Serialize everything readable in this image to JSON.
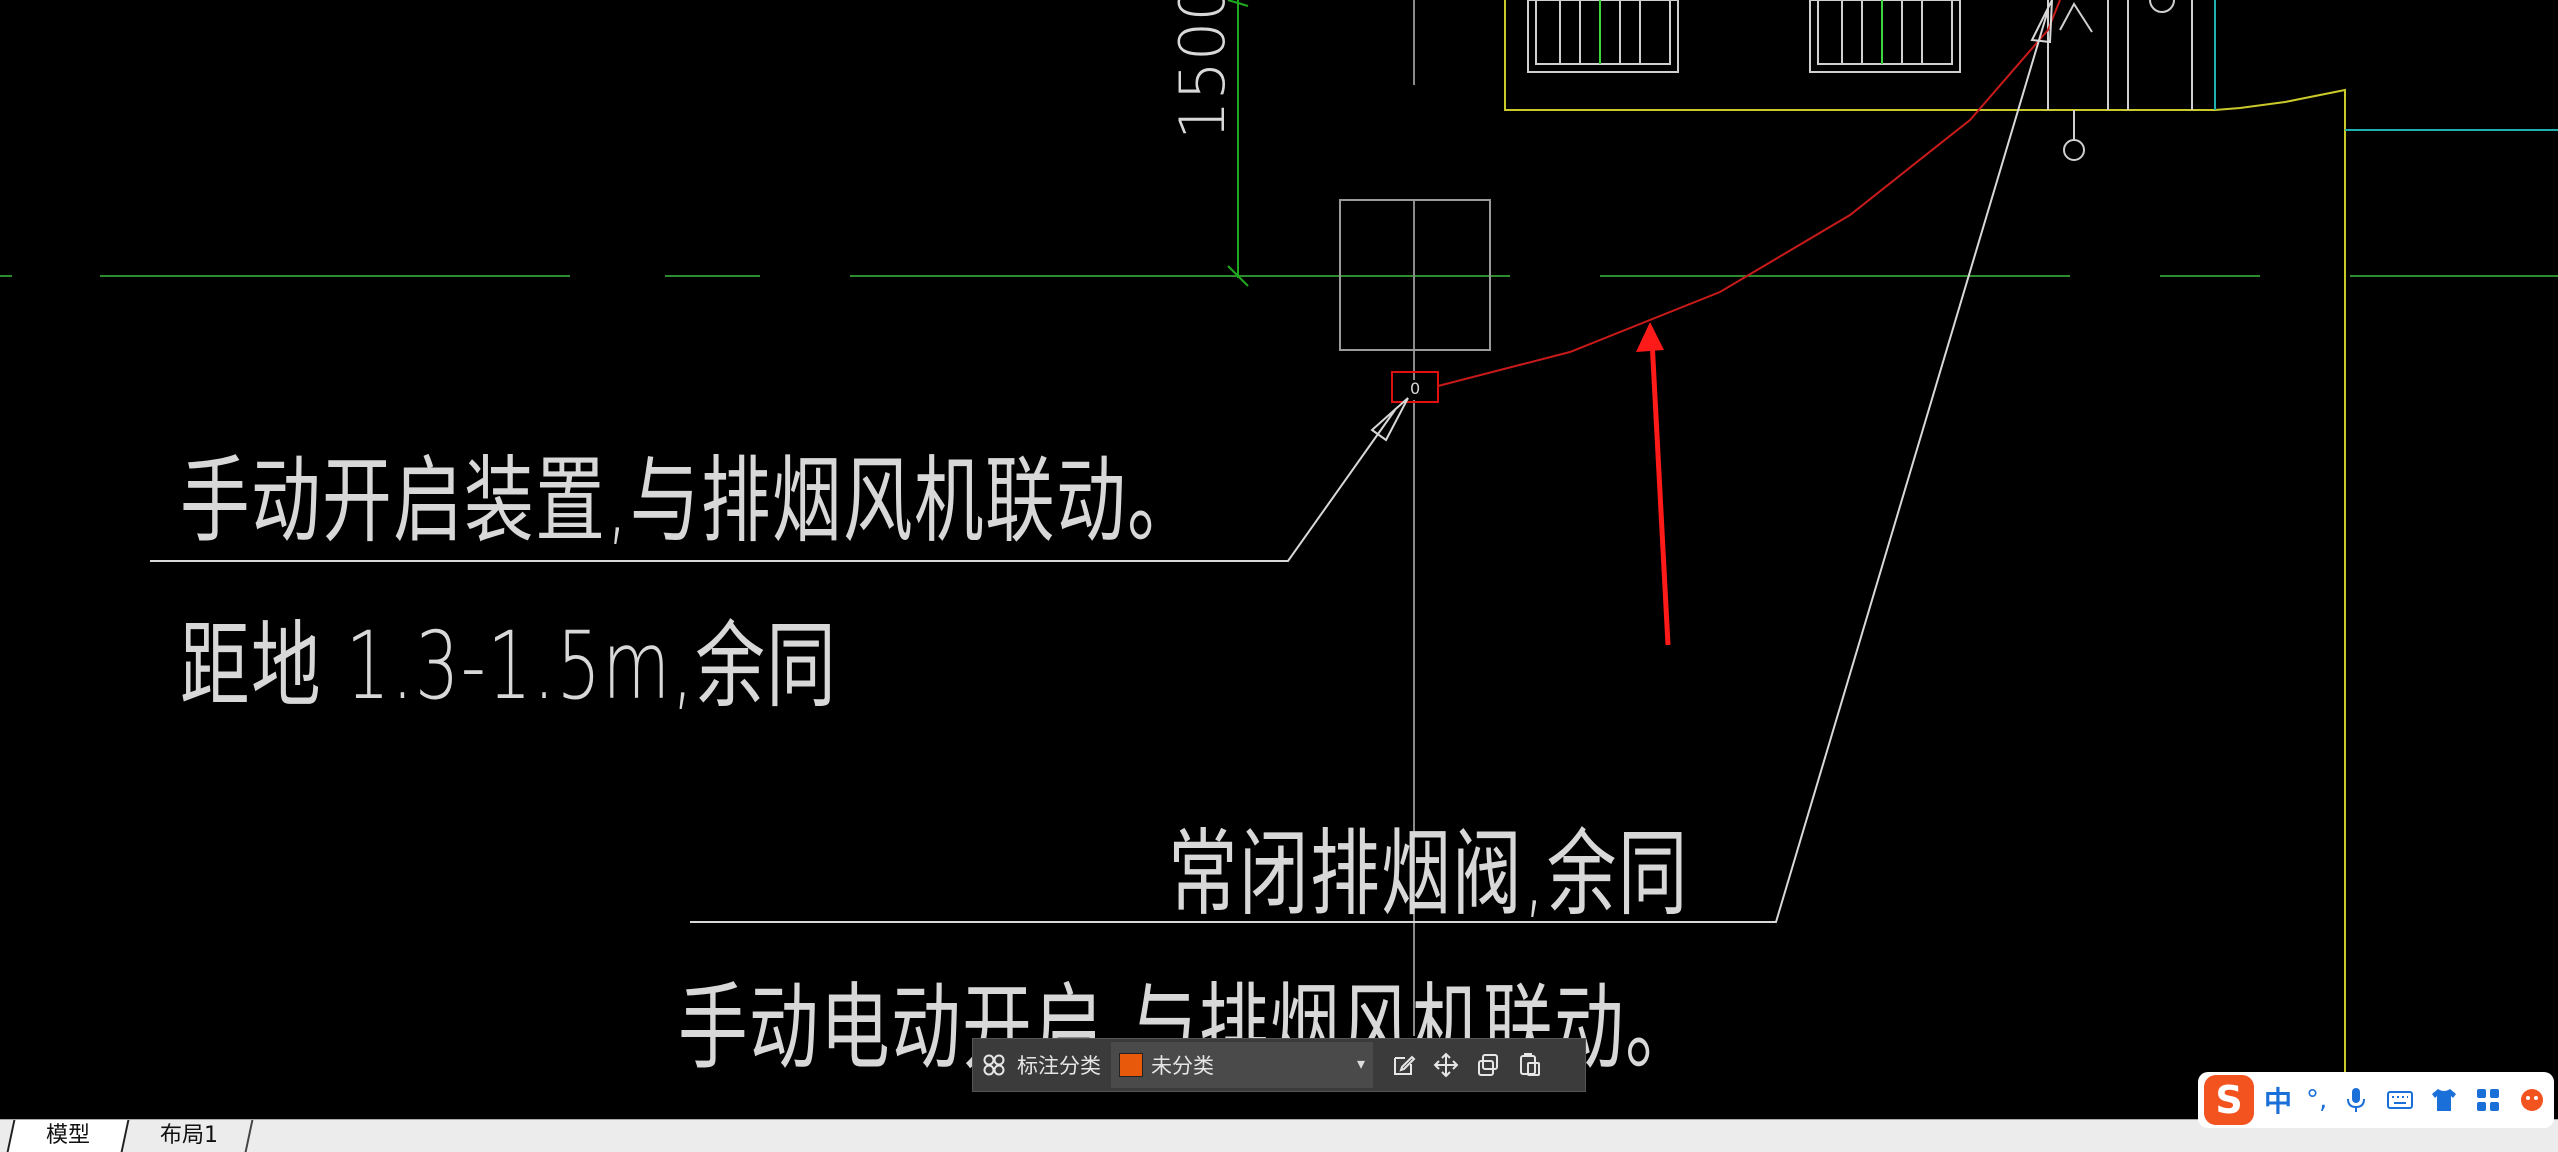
{
  "drawing": {
    "dimension_label": "1500",
    "annotations": [
      "手动开启装置,与排烟风机联动。",
      "距地 1.3-1.5m,余同",
      "常闭排烟阀,余同",
      "手动电动开启,与排烟风机联动。"
    ]
  },
  "annotation_toolbar": {
    "category_label": "标注分类",
    "category_value": "未分类",
    "swatch_color": "#e8590c",
    "icons": [
      "category-grid-icon",
      "edit-icon",
      "move-icon",
      "copy-icon",
      "paste-icon"
    ]
  },
  "layout_tabs": [
    "模型",
    "布局1"
  ],
  "ime": {
    "logo": "S",
    "language": "中",
    "icons": [
      "punctuation-icon",
      "microphone-icon",
      "keyboard-icon",
      "skin-icon",
      "toolbox-icon",
      "mascot-icon"
    ]
  }
}
